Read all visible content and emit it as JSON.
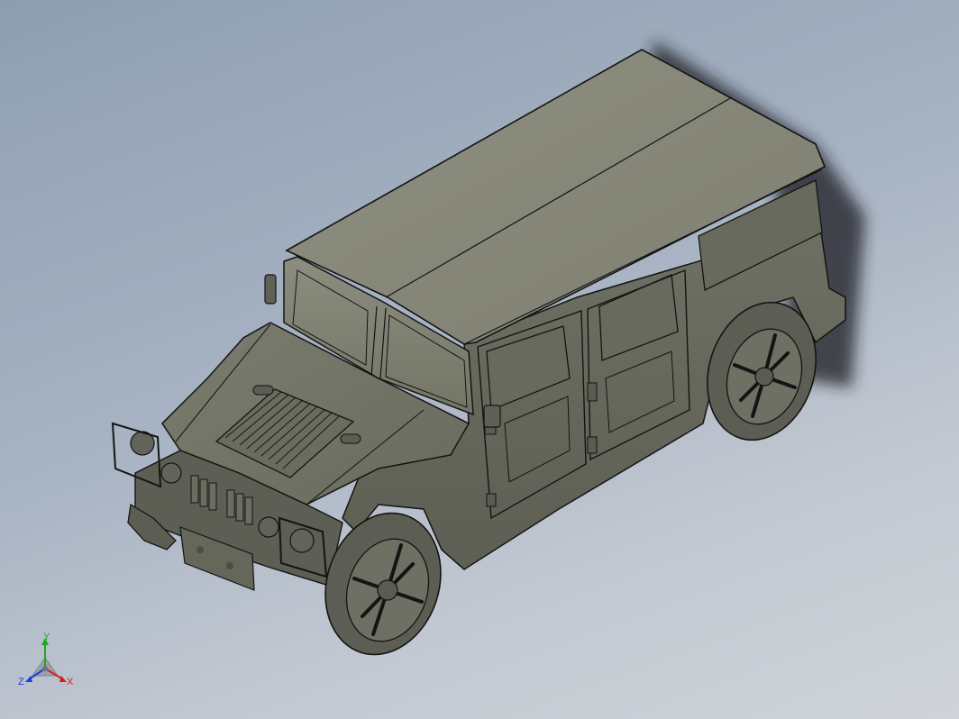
{
  "viewport": {
    "background_top": "#8e9eb1",
    "background_bottom": "#cfd3d9"
  },
  "model": {
    "body_color": "#6f7164",
    "roof_color": "#8a8b7d",
    "edge_color": "#141414",
    "shadow_color": "#1a1d24"
  },
  "triad": {
    "x_label": "X",
    "y_label": "Y",
    "z_label": "Z",
    "x_color": "#d62020",
    "y_color": "#1fa71f",
    "z_color": "#1e3fd8"
  }
}
